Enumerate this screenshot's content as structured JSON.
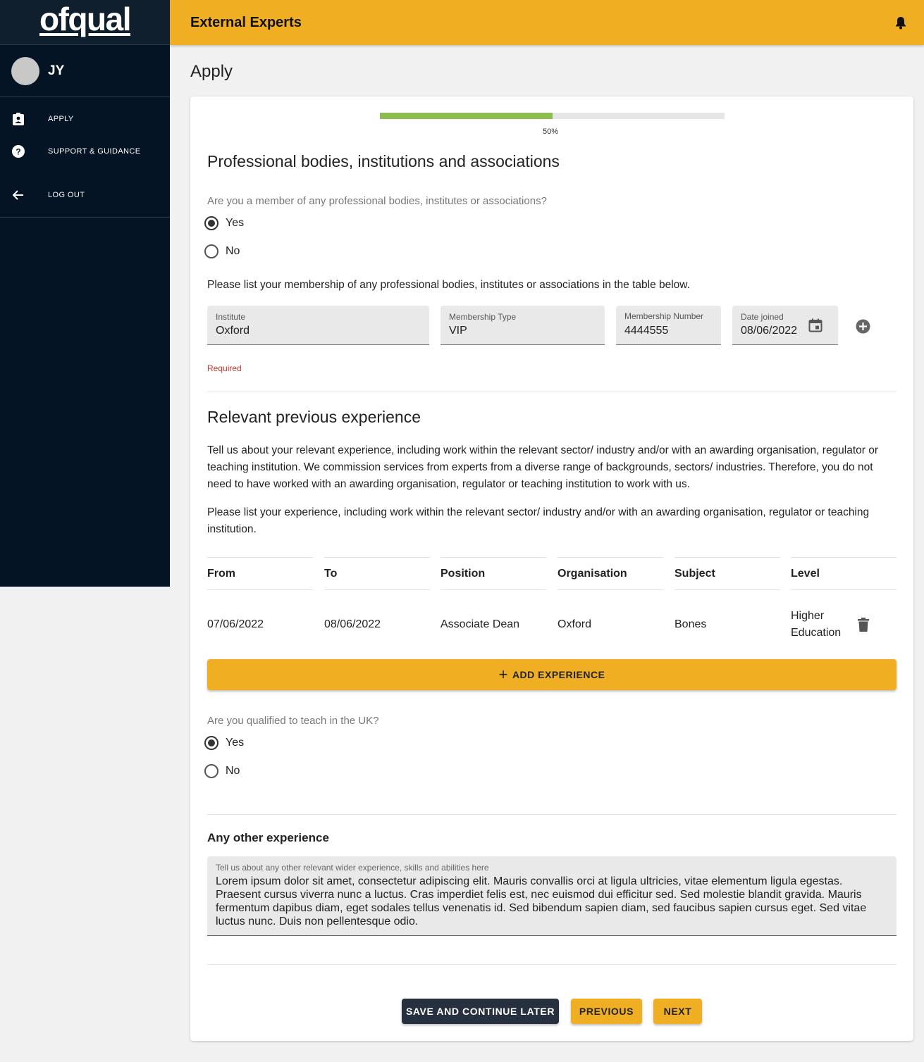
{
  "brand": {
    "logo_text": "ofqual"
  },
  "user": {
    "initials": "JY"
  },
  "sidebar": {
    "items": [
      {
        "label": "APPLY",
        "icon": "clipboard-icon"
      },
      {
        "label": "SUPPORT & GUIDANCE",
        "icon": "help-icon"
      },
      {
        "label": "LOG OUT",
        "icon": "arrow-left-icon"
      }
    ]
  },
  "header": {
    "title": "External Experts",
    "icon": "bell-icon"
  },
  "page": {
    "title": "Apply"
  },
  "progress": {
    "value_fraction": 0.5,
    "label": "50%"
  },
  "memberships": {
    "heading": "Professional bodies, institutions and associations",
    "question": "Are you a member of any professional bodies, institutes or associations?",
    "options": [
      "Yes",
      "No"
    ],
    "selected": "Yes",
    "instruction": "Please list your membership of any professional bodies, institutes or associations in the table below.",
    "fields": {
      "institute": {
        "label": "Institute",
        "value": "Oxford"
      },
      "membership_type": {
        "label": "Membership Type",
        "value": "VIP"
      },
      "membership_number": {
        "label": "Membership Number",
        "value": "4444555"
      },
      "date_joined": {
        "label": "Date joined",
        "value": "08/06/2022"
      }
    },
    "error": "Required"
  },
  "experience": {
    "heading": "Relevant previous experience",
    "para1": "Tell us about your relevant experience, including work within the relevant sector/ industry and/or with an awarding organisation, regulator or teaching institution. We commission services from experts from a diverse range of backgrounds, sectors/ industries. Therefore, you do not need to have worked with an awarding organisation, regulator or teaching institution to work with us.",
    "para2": "Please list your experience, including work within the relevant sector/ industry and/or with an awarding organisation, regulator or teaching institution.",
    "columns": [
      "From",
      "To",
      "Position",
      "Organisation",
      "Subject",
      "Level"
    ],
    "rows": [
      {
        "from": "07/06/2022",
        "to": "08/06/2022",
        "position": "Associate Dean",
        "organisation": "Oxford",
        "subject": "Bones",
        "level": "Higher Education"
      }
    ],
    "add_label": "ADD EXPERIENCE"
  },
  "teaching": {
    "question": "Are you qualified to teach in the UK?",
    "options": [
      "Yes",
      "No"
    ],
    "selected": "Yes"
  },
  "other": {
    "heading": "Any other experience",
    "label": "Tell us about any other relevant wider experience, skills and abilities here",
    "value": "Lorem ipsum dolor sit amet, consectetur adipiscing elit. Mauris convallis orci at ligula ultricies, vitae elementum ligula egestas. Praesent cursus viverra nunc a luctus. Cras imperdiet felis est, nec euismod dui efficitur sed. Sed molestie blandit gravida. Mauris fermentum dapibus diam, eget sodales tellus venenatis id. Sed bibendum sapien diam, sed faucibus sapien cursus eget. Sed vitae luctus nunc. Duis non pellentesque odio."
  },
  "actions": {
    "save_later": "SAVE AND CONTINUE LATER",
    "previous": "PREVIOUS",
    "next": "NEXT"
  },
  "colors": {
    "accent": "#f0ae23",
    "sidebar": "#041424",
    "progress": "#8cbd4e",
    "error": "#c0392b"
  }
}
